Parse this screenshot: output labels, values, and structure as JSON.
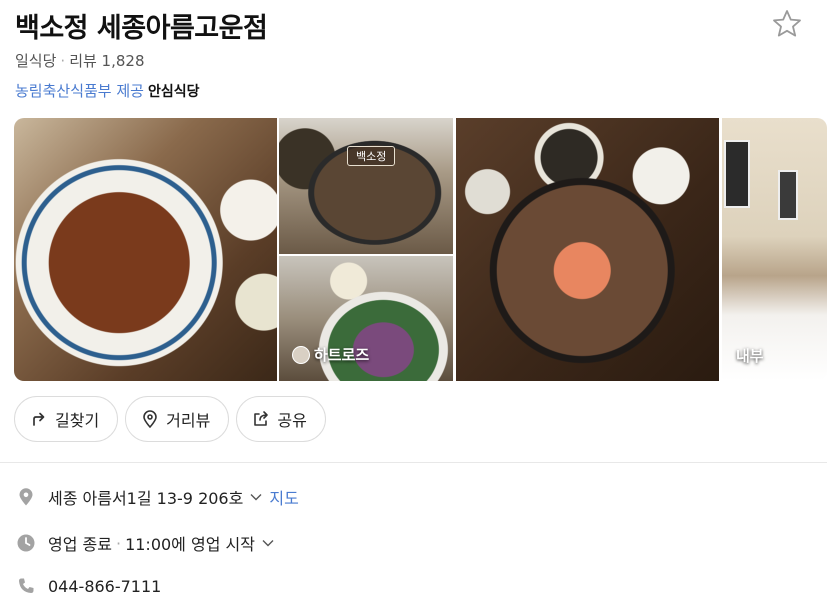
{
  "place": {
    "name": "백소정 세종아름고운점",
    "category": "일식당",
    "review_label": "리뷰 1,828",
    "provider_label": "농림축산식품부 제공",
    "provider_badge": "안심식당"
  },
  "photos": {
    "sign_text": "백소정",
    "label_review": "하트로즈",
    "label_interior": "내부"
  },
  "actions": [
    {
      "label": "길찾기",
      "icon": "directions-icon"
    },
    {
      "label": "거리뷰",
      "icon": "pin-icon"
    },
    {
      "label": "공유",
      "icon": "share-icon"
    }
  ],
  "info": {
    "address": "세종 아름서1길 13-9 206호",
    "map_link": "지도",
    "status": "영업 종료",
    "next_open": "11:00에 영업 시작",
    "phone": "044-866-7111"
  },
  "colors": {
    "link_blue": "#4a7bd0",
    "icon_gray": "#9a9a9a",
    "border": "#dcdcdc"
  }
}
